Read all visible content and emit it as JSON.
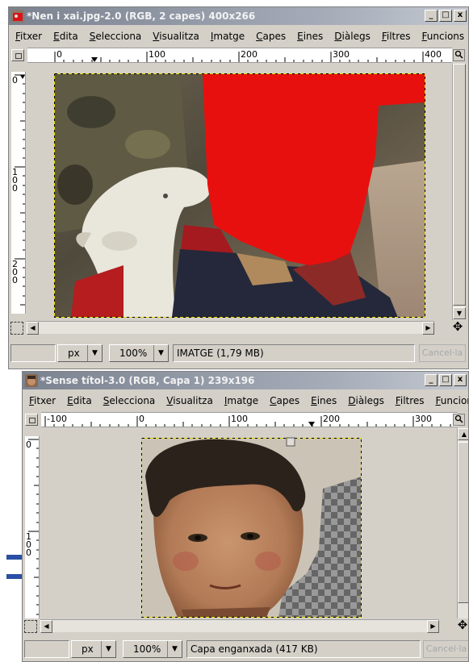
{
  "window1": {
    "title": "*Nen i xai.jpg-2.0 (RGB, 2 capes) 400x266",
    "title_buttons": [
      "_",
      "□",
      "x"
    ],
    "menu": [
      "Fitxer",
      "Edita",
      "Selecciona",
      "Visualitza",
      "Imatge",
      "Capes",
      "Eines",
      "Diàlegs",
      "Filtres",
      "Funcions"
    ],
    "hruler_labels": [
      "0",
      "100",
      "200",
      "300",
      "400"
    ],
    "vruler_labels": [
      "0",
      "100",
      "200"
    ],
    "status": {
      "unit": "px",
      "zoom": "100%",
      "message": "IMATGE (1,79 MB)",
      "cancel": "Cancel·la"
    },
    "colors": {
      "red_fill": "#e8100e"
    }
  },
  "window2": {
    "title": "*Sense títol-3.0 (RGB, Capa 1) 239x196",
    "title_buttons": [
      "_",
      "□",
      "x"
    ],
    "menu": [
      "Fitxer",
      "Edita",
      "Selecciona",
      "Visualitza",
      "Imatge",
      "Capes",
      "Eines",
      "Diàlegs",
      "Filtres",
      "Funcions"
    ],
    "hruler_labels": [
      "-100",
      "0",
      "100",
      "200",
      "300"
    ],
    "vruler_labels": [
      "0",
      "100"
    ],
    "status": {
      "unit": "px",
      "zoom": "100%",
      "message": "Capa enganxada (417 KB)",
      "cancel": "Cancel·la"
    }
  },
  "icons": {
    "dropdown": "▼",
    "navigate": "✥",
    "zoom_toggle": "🔍"
  }
}
